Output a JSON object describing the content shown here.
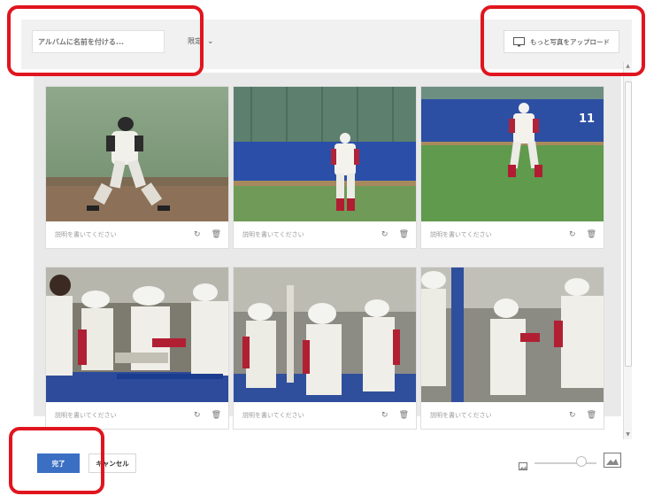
{
  "header": {
    "album_name_placeholder": "アルバムに名前を付ける...",
    "share_label": "限定",
    "upload_label": "もっと写真をアップロード"
  },
  "photos": [
    {
      "caption_placeholder": "説明を書いてください"
    },
    {
      "caption_placeholder": "説明を書いてください"
    },
    {
      "caption_placeholder": "説明を書いてください"
    },
    {
      "caption_placeholder": "説明を書いてください"
    },
    {
      "caption_placeholder": "説明を書いてください"
    },
    {
      "caption_placeholder": "説明を書いてください"
    }
  ],
  "photo_numbers": {
    "scoreboard_number": "11"
  },
  "footer": {
    "done_label": "完了",
    "cancel_label": "キャンセル",
    "zoom_level": 0.75
  },
  "colors": {
    "accent": "#3a6fc4",
    "highlight": "#e0151f"
  },
  "icons": {
    "rotate": "rotate-icon",
    "delete": "trash-icon",
    "upload": "monitor-icon",
    "zoom_out": "small-image-icon",
    "zoom_in": "large-image-icon"
  }
}
